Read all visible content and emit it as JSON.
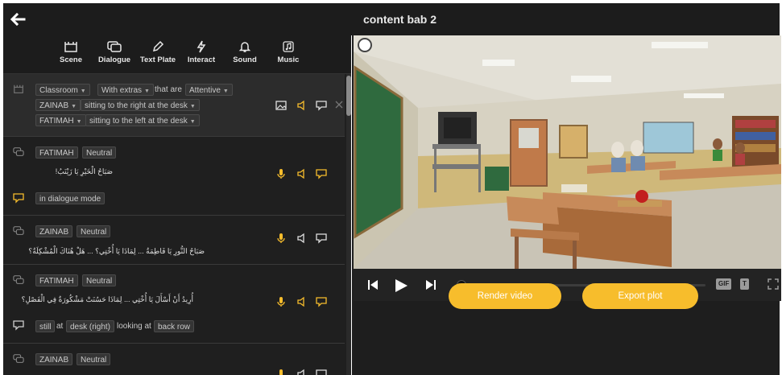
{
  "header": {
    "title": "content bab 2",
    "back_icon": "arrow-left-icon"
  },
  "toolbar": {
    "tools": [
      {
        "label": "Scene",
        "icon": "scene-icon"
      },
      {
        "label": "Dialogue",
        "icon": "dialogue-icon"
      },
      {
        "label": "Text Plate",
        "icon": "pen-icon"
      },
      {
        "label": "Interact",
        "icon": "interact-icon"
      },
      {
        "label": "Sound",
        "icon": "bell-icon"
      },
      {
        "label": "Music",
        "icon": "music-icon"
      }
    ]
  },
  "scene_block": {
    "location": "Classroom",
    "extras": "With extras",
    "that_are": "that are",
    "extras_mood": "Attentive",
    "char1": "ZAINAB",
    "char1_position": "sitting to the right at the desk",
    "char2": "FATIMAH",
    "char2_position": "sitting to the left at the desk"
  },
  "dialogues": [
    {
      "character": "FATIMAH",
      "emotion": "Neutral",
      "line": "صَبَاحُ الْخَيْرِ يَا زَيْنَبُ!",
      "mode": "in dialogue mode"
    },
    {
      "character": "ZAINAB",
      "emotion": "Neutral",
      "line": "صَبَاحُ النُّورِ يَا فَاطِمَةُ ... لِمَاذَا يَا أُخْتِي؟ ... هَلْ هُنَاكَ الْمُشْكِلَةُ؟"
    },
    {
      "character": "FATIMAH",
      "emotion": "Neutral",
      "line": "أُرِيدُ أَنْ أَسْأَلَ يَا أُخْتِي ... لِمَاذَا حَسُنَتْ مَشْكُورَةٌ فِي الْفَصْلِ؟",
      "action": {
        "state": "still",
        "at": "at",
        "place": "desk (right)",
        "looking": "looking at",
        "target": "back row"
      }
    },
    {
      "character": "ZAINAB",
      "emotion": "Neutral"
    }
  ],
  "player": {
    "gif_label": "GIF",
    "t_label": "T"
  },
  "actions": {
    "render": "Render video",
    "export": "Export plot"
  },
  "colors": {
    "accent": "#f7bd2c",
    "panel": "#1f1f1f",
    "scene_row": "#2c2c2c"
  }
}
